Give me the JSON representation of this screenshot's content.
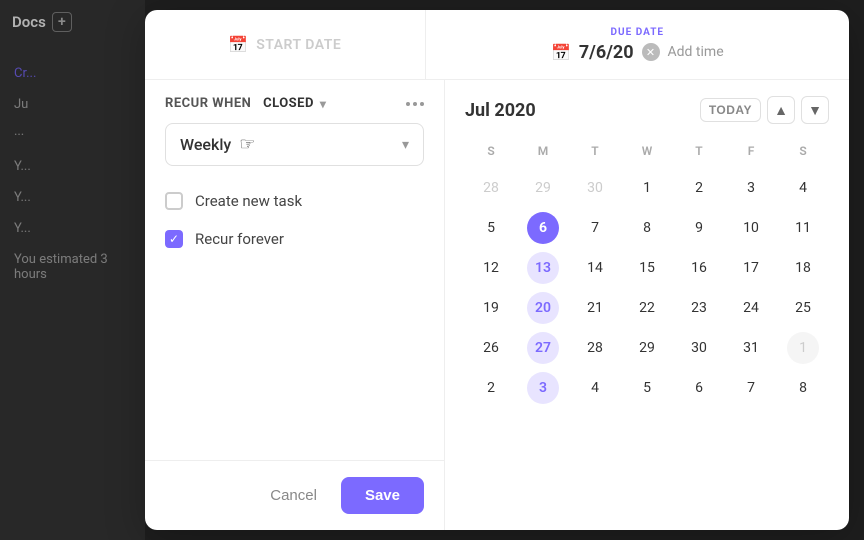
{
  "background": {
    "app_name": "Docs",
    "items": [
      "Cr...",
      "Ju",
      "Y...",
      "Y...",
      "Y...",
      "You estimated 3 hours"
    ]
  },
  "dialog": {
    "start_date": {
      "label": "START DATE",
      "icon": "calendar-icon"
    },
    "due_date": {
      "top_label": "DUE DATE",
      "value": "7/6/20",
      "icon": "calendar-icon",
      "add_time": "Add time"
    },
    "recur": {
      "title_part1": "RECUR WHEN",
      "title_part2": "CLOSED",
      "frequency": "Weekly",
      "options": [
        {
          "id": "create_new_task",
          "label": "Create new task",
          "checked": false
        },
        {
          "id": "recur_forever",
          "label": "Recur forever",
          "checked": true
        }
      ]
    },
    "footer": {
      "cancel_label": "Cancel",
      "save_label": "Save"
    },
    "calendar": {
      "month_year": "Jul 2020",
      "today_label": "TODAY",
      "day_headers": [
        "S",
        "M",
        "T",
        "W",
        "T",
        "F",
        "S"
      ],
      "weeks": [
        [
          {
            "num": "28",
            "other": true
          },
          {
            "num": "29",
            "other": true
          },
          {
            "num": "30",
            "other": true
          },
          {
            "num": "1",
            "other": false
          },
          {
            "num": "2",
            "other": false
          },
          {
            "num": "3",
            "other": false
          },
          {
            "num": "4",
            "other": false
          }
        ],
        [
          {
            "num": "5",
            "other": false
          },
          {
            "num": "6",
            "other": false,
            "today": true
          },
          {
            "num": "7",
            "other": false
          },
          {
            "num": "8",
            "other": false
          },
          {
            "num": "9",
            "other": false
          },
          {
            "num": "10",
            "other": false
          },
          {
            "num": "11",
            "other": false
          }
        ],
        [
          {
            "num": "12",
            "other": false
          },
          {
            "num": "13",
            "other": false,
            "highlight": true
          },
          {
            "num": "14",
            "other": false
          },
          {
            "num": "15",
            "other": false
          },
          {
            "num": "16",
            "other": false
          },
          {
            "num": "17",
            "other": false
          },
          {
            "num": "18",
            "other": false
          }
        ],
        [
          {
            "num": "19",
            "other": false
          },
          {
            "num": "20",
            "other": false,
            "highlight": true
          },
          {
            "num": "21",
            "other": false
          },
          {
            "num": "22",
            "other": false
          },
          {
            "num": "23",
            "other": false
          },
          {
            "num": "24",
            "other": false
          },
          {
            "num": "25",
            "other": false
          }
        ],
        [
          {
            "num": "26",
            "other": false
          },
          {
            "num": "27",
            "other": false,
            "highlight": true
          },
          {
            "num": "28",
            "other": false
          },
          {
            "num": "29",
            "other": false
          },
          {
            "num": "30",
            "other": false
          },
          {
            "num": "31",
            "other": false
          },
          {
            "num": "1",
            "other": true,
            "outside_box": true
          }
        ],
        [
          {
            "num": "2",
            "other": false
          },
          {
            "num": "3",
            "other": false,
            "highlight": true
          },
          {
            "num": "4",
            "other": false
          },
          {
            "num": "5",
            "other": false
          },
          {
            "num": "6",
            "other": false
          },
          {
            "num": "7",
            "other": false
          },
          {
            "num": "8",
            "other": false
          }
        ]
      ]
    }
  }
}
